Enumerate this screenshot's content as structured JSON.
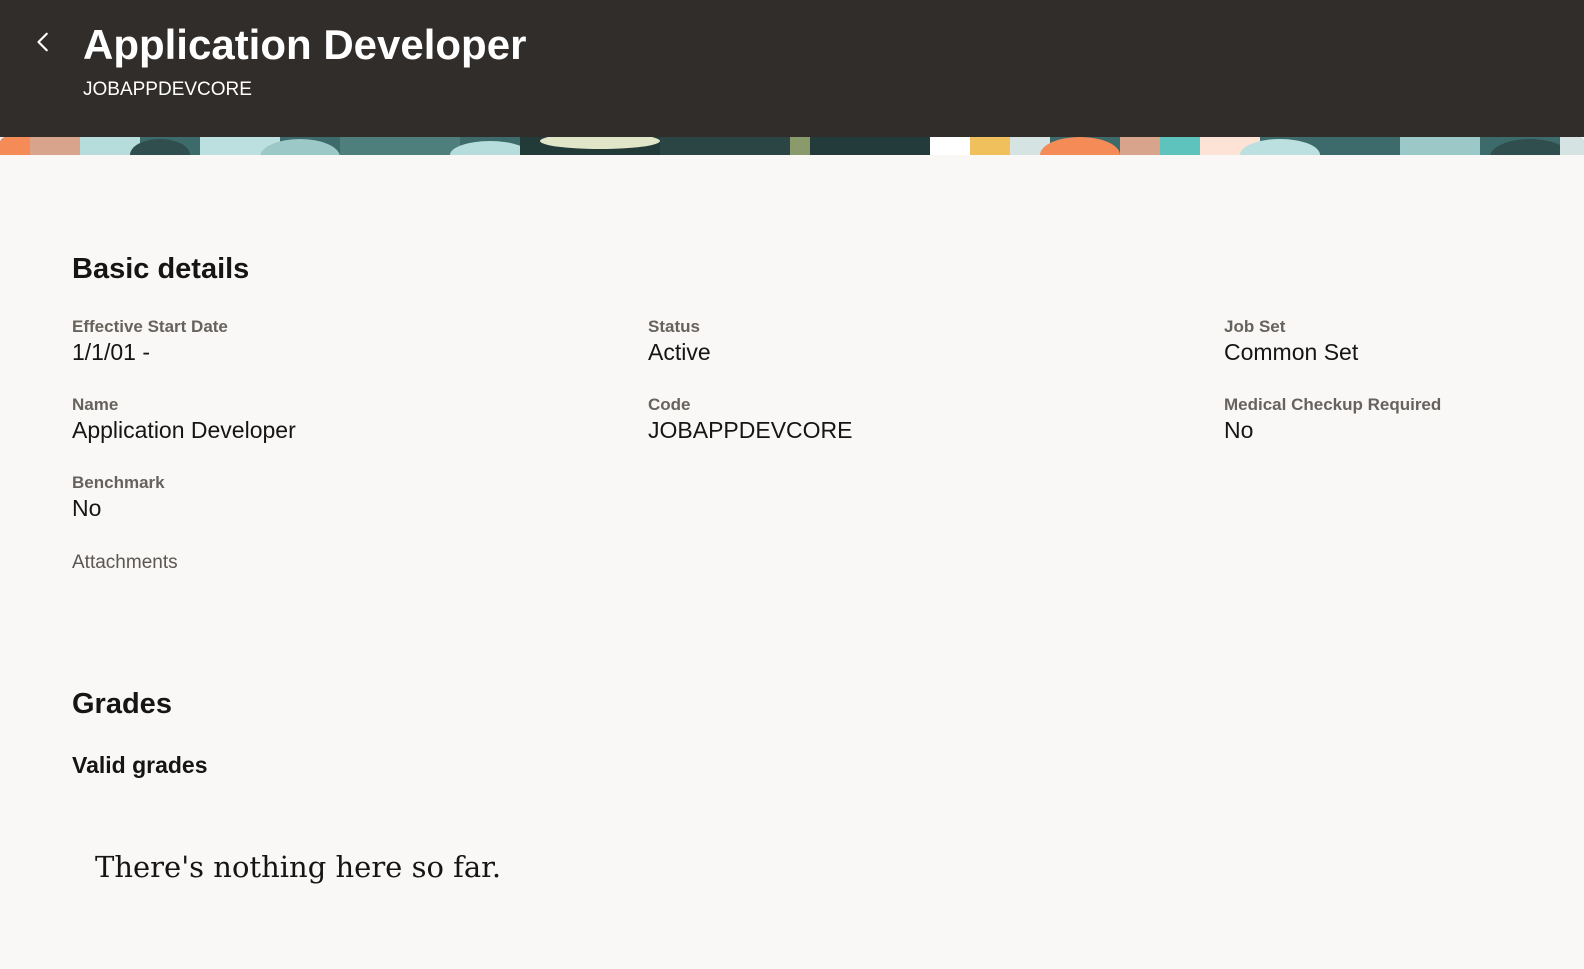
{
  "header": {
    "title": "Application Developer",
    "subtitle": "JOBAPPDEVCORE",
    "back_icon": "chevron-left-icon"
  },
  "colors": {
    "header_bg": "#312d2a",
    "page_bg": "#f9f8f6",
    "text": "#161513",
    "label": "#5b5652"
  },
  "basic_details": {
    "title": "Basic details",
    "fields": {
      "effective_start_date": {
        "label": "Effective Start Date",
        "value": "1/1/01 -"
      },
      "status": {
        "label": "Status",
        "value": "Active"
      },
      "job_set": {
        "label": "Job Set",
        "value": "Common Set"
      },
      "name": {
        "label": "Name",
        "value": "Application Developer"
      },
      "code": {
        "label": "Code",
        "value": "JOBAPPDEVCORE"
      },
      "medical_checkup_required": {
        "label": "Medical Checkup Required",
        "value": "No"
      },
      "benchmark": {
        "label": "Benchmark",
        "value": "No"
      }
    },
    "attachments_label": "Attachments"
  },
  "grades": {
    "title": "Grades",
    "valid_grades_title": "Valid grades",
    "empty_message": "There's nothing here so far."
  }
}
